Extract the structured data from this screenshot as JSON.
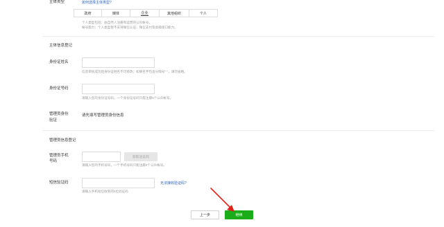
{
  "subject_type": {
    "label": "主体类型",
    "help_link": "如何选择主体类型?",
    "options": [
      "政府",
      "媒体",
      "企业",
      "其他组织",
      "个人"
    ],
    "selected": "企业",
    "hint_line1": "个人类型包括：由自然人注册和运营的公众帐号。",
    "hint_line2": "帐号能力：个人类型暂不支持微信认证、微信支付及高级接口能力。"
  },
  "info_section": {
    "title": "主体信息登记",
    "id_name_label": "身份证姓名",
    "id_name_value": "",
    "id_name_hint": "信息审核成功后身份证姓名不可修改；如果名字包含分隔号\"·\"，请勿省略。",
    "id_number_label": "身份证号码",
    "id_number_value": "",
    "id_number_hint": "请输入您的身份证号码，一个身份证号码只能注册5个公众帐号。",
    "verify_label_line1": "管理员身份",
    "verify_label_line2": "验证",
    "verify_text": "请先填写管理员身份信息"
  },
  "admin_section": {
    "title": "管理员信息登记",
    "phone_label_line1": "管理员手机",
    "phone_label_line2": "号码",
    "phone_value": "",
    "get_code_button": "获取验证码",
    "phone_hint": "请输入您的手机号码，一个手机号码只能注册5个公众帐号。",
    "sms_label": "短信验证码",
    "sms_value": "",
    "sms_link": "无法接收验证码?",
    "sms_hint": "请输入手机短信收到的6位验证码"
  },
  "footer": {
    "prev_button": "上一步",
    "next_button": "继续"
  },
  "colors": {
    "accent_green": "#1aad19",
    "link_blue": "#2a62c4",
    "arrow_red": "#e0241b"
  }
}
